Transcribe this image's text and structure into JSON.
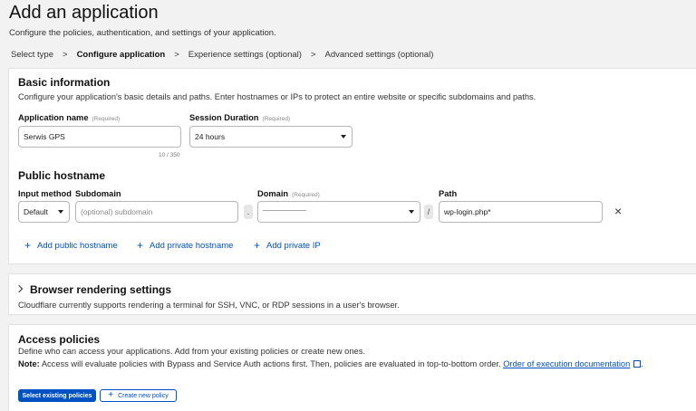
{
  "header": {
    "title": "Add an application",
    "subtitle": "Configure the policies, authentication, and settings of your application."
  },
  "steps": [
    {
      "label": "Select type",
      "active": false
    },
    {
      "label": "Configure application",
      "active": true
    },
    {
      "label": "Experience settings (optional)",
      "active": false
    },
    {
      "label": "Advanced settings (optional)",
      "active": false
    }
  ],
  "step_separator": ">",
  "basic": {
    "title": "Basic information",
    "description": "Configure your application's basic details and paths. Enter hostnames or IPs to protect an entire website or specific subdomains and paths.",
    "app_name_label": "Application name",
    "app_name_required": "(Required)",
    "app_name_value": "Serwis GPS",
    "app_name_counter": "10 / 350",
    "session_label": "Session Duration",
    "session_required": "(Required)",
    "session_value": "24 hours"
  },
  "hostname": {
    "title": "Public hostname",
    "input_method_label": "Input method",
    "input_method_value": "Default",
    "subdomain_label": "Subdomain",
    "subdomain_placeholder": "(optional) subdomain",
    "dot": ".",
    "domain_label": "Domain",
    "domain_required": "(Required)",
    "slash": "/",
    "path_label": "Path",
    "path_value": "wp-login.php*",
    "close_symbol": "×",
    "add_public_label": "Add public hostname",
    "add_private_label": "Add private hostname",
    "add_ip_label": "Add private IP",
    "plus_symbol": "+"
  },
  "browser": {
    "title": "Browser rendering settings",
    "description": "Cloudflare currently supports rendering a terminal for SSH, VNC, or RDP sessions in a user's browser."
  },
  "access": {
    "title": "Access policies",
    "description": "Define who can access your applications. Add from your existing policies or create new ones.",
    "note_label": "Note:",
    "note_text": " Access will evaluate policies with Bypass and Service Auth actions first. Then, policies are evaluated in top-to-bottom order. ",
    "doc_link": "Order of execution documentation",
    "note_end": ".",
    "select_existing_label": "Select existing policies",
    "create_new_label": "Create new policy"
  },
  "colors": {
    "accent": "#0051c3",
    "background": "#f2f2f2",
    "card": "#ffffff"
  }
}
